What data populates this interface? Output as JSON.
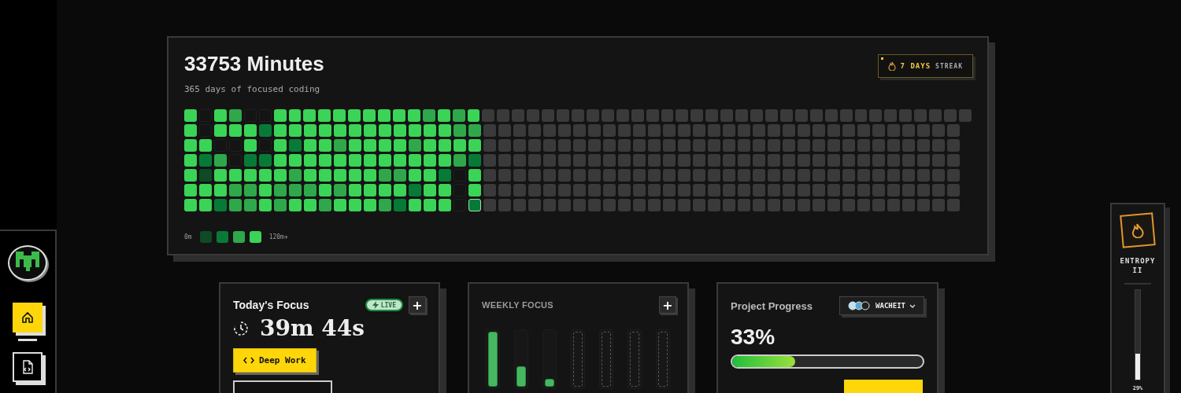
{
  "sidebar": {
    "nav_items": [
      {
        "kind": "home",
        "selected": true
      },
      {
        "kind": "code-file",
        "selected": false
      }
    ]
  },
  "activity": {
    "title": "33753 Minutes",
    "subtitle": "365 days of focused coding",
    "streak": {
      "value": "7 DAYS",
      "label": "STREAK"
    },
    "rows": [
      {
        "cells": [
          {
            "kind": "day",
            "color": "#3ad457"
          },
          {
            "kind": "day",
            "color": "#141414"
          },
          {
            "kind": "day",
            "color": "#3ad457"
          },
          {
            "kind": "day",
            "color": "#2ea84a"
          },
          {
            "kind": "day",
            "color": "#141414"
          },
          {
            "kind": "day",
            "color": "#141414"
          },
          {
            "kind": "day",
            "color": "#3ad457"
          },
          {
            "kind": "day",
            "color": "#3ad457"
          },
          {
            "kind": "day",
            "color": "#3ad457"
          },
          {
            "kind": "day",
            "color": "#3ad457"
          },
          {
            "kind": "day",
            "color": "#3ad457"
          },
          {
            "kind": "day",
            "color": "#3ad457"
          },
          {
            "kind": "day",
            "color": "#3ad457"
          },
          {
            "kind": "day",
            "color": "#3ad457"
          },
          {
            "kind": "day",
            "color": "#3ad457"
          },
          {
            "kind": "day",
            "color": "#3ad457"
          },
          {
            "kind": "day",
            "color": "#2ea84a"
          },
          {
            "kind": "day",
            "color": "#3ad457"
          },
          {
            "kind": "day",
            "color": "#2ea84a"
          },
          {
            "kind": "day",
            "color": "#3ad457"
          },
          {
            "kind": "future",
            "color": "#3a3a3a"
          },
          {
            "kind": "future",
            "color": "#3a3a3a"
          },
          {
            "kind": "future",
            "color": "#3a3a3a"
          },
          {
            "kind": "future",
            "color": "#3a3a3a"
          },
          {
            "kind": "future",
            "color": "#3a3a3a"
          },
          {
            "kind": "future",
            "color": "#3a3a3a"
          },
          {
            "kind": "future",
            "color": "#3a3a3a"
          },
          {
            "kind": "future",
            "color": "#3a3a3a"
          },
          {
            "kind": "future",
            "color": "#3a3a3a"
          },
          {
            "kind": "future",
            "color": "#3a3a3a"
          },
          {
            "kind": "future",
            "color": "#3a3a3a"
          },
          {
            "kind": "future",
            "color": "#3a3a3a"
          },
          {
            "kind": "future",
            "color": "#3a3a3a"
          },
          {
            "kind": "future",
            "color": "#3a3a3a"
          },
          {
            "kind": "future",
            "color": "#3a3a3a"
          },
          {
            "kind": "future",
            "color": "#3a3a3a"
          },
          {
            "kind": "future",
            "color": "#3a3a3a"
          },
          {
            "kind": "future",
            "color": "#3a3a3a"
          },
          {
            "kind": "future",
            "color": "#3a3a3a"
          },
          {
            "kind": "future",
            "color": "#3a3a3a"
          },
          {
            "kind": "future",
            "color": "#3a3a3a"
          },
          {
            "kind": "future",
            "color": "#3a3a3a"
          },
          {
            "kind": "future",
            "color": "#3a3a3a"
          },
          {
            "kind": "future",
            "color": "#3a3a3a"
          },
          {
            "kind": "future",
            "color": "#3a3a3a"
          },
          {
            "kind": "future",
            "color": "#3a3a3a"
          },
          {
            "kind": "future",
            "color": "#3a3a3a"
          },
          {
            "kind": "future",
            "color": "#3a3a3a"
          },
          {
            "kind": "future",
            "color": "#3a3a3a"
          },
          {
            "kind": "future",
            "color": "#3a3a3a"
          },
          {
            "kind": "future",
            "color": "#3a3a3a"
          },
          {
            "kind": "future",
            "color": "#3a3a3a"
          },
          {
            "kind": "future",
            "color": "#3a3a3a"
          }
        ]
      },
      {
        "cells": [
          {
            "kind": "day",
            "color": "#3ad457"
          },
          {
            "kind": "day",
            "color": "#141414"
          },
          {
            "kind": "day",
            "color": "#3ad457"
          },
          {
            "kind": "day",
            "color": "#3ad457"
          },
          {
            "kind": "day",
            "color": "#3ad457"
          },
          {
            "kind": "day",
            "color": "#077a37"
          },
          {
            "kind": "day",
            "color": "#3ad457"
          },
          {
            "kind": "day",
            "color": "#3ad457"
          },
          {
            "kind": "day",
            "color": "#3ad457"
          },
          {
            "kind": "day",
            "color": "#3ad457"
          },
          {
            "kind": "day",
            "color": "#3ad457"
          },
          {
            "kind": "day",
            "color": "#3ad457"
          },
          {
            "kind": "day",
            "color": "#3ad457"
          },
          {
            "kind": "day",
            "color": "#3ad457"
          },
          {
            "kind": "day",
            "color": "#3ad457"
          },
          {
            "kind": "day",
            "color": "#3ad457"
          },
          {
            "kind": "day",
            "color": "#3ad457"
          },
          {
            "kind": "day",
            "color": "#3ad457"
          },
          {
            "kind": "day",
            "color": "#2ea84a"
          },
          {
            "kind": "day",
            "color": "#2ea84a"
          },
          {
            "kind": "future",
            "color": "#3a3a3a"
          },
          {
            "kind": "future",
            "color": "#3a3a3a"
          },
          {
            "kind": "future",
            "color": "#3a3a3a"
          },
          {
            "kind": "future",
            "color": "#3a3a3a"
          },
          {
            "kind": "future",
            "color": "#3a3a3a"
          },
          {
            "kind": "future",
            "color": "#3a3a3a"
          },
          {
            "kind": "future",
            "color": "#3a3a3a"
          },
          {
            "kind": "future",
            "color": "#3a3a3a"
          },
          {
            "kind": "future",
            "color": "#3a3a3a"
          },
          {
            "kind": "future",
            "color": "#3a3a3a"
          },
          {
            "kind": "future",
            "color": "#3a3a3a"
          },
          {
            "kind": "future",
            "color": "#3a3a3a"
          },
          {
            "kind": "future",
            "color": "#3a3a3a"
          },
          {
            "kind": "future",
            "color": "#3a3a3a"
          },
          {
            "kind": "future",
            "color": "#3a3a3a"
          },
          {
            "kind": "future",
            "color": "#3a3a3a"
          },
          {
            "kind": "future",
            "color": "#3a3a3a"
          },
          {
            "kind": "future",
            "color": "#3a3a3a"
          },
          {
            "kind": "future",
            "color": "#3a3a3a"
          },
          {
            "kind": "future",
            "color": "#3a3a3a"
          },
          {
            "kind": "future",
            "color": "#3a3a3a"
          },
          {
            "kind": "future",
            "color": "#3a3a3a"
          },
          {
            "kind": "future",
            "color": "#3a3a3a"
          },
          {
            "kind": "future",
            "color": "#3a3a3a"
          },
          {
            "kind": "future",
            "color": "#3a3a3a"
          },
          {
            "kind": "future",
            "color": "#3a3a3a"
          },
          {
            "kind": "future",
            "color": "#3a3a3a"
          },
          {
            "kind": "future",
            "color": "#3a3a3a"
          },
          {
            "kind": "future",
            "color": "#3a3a3a"
          },
          {
            "kind": "future",
            "color": "#3a3a3a"
          },
          {
            "kind": "future",
            "color": "#3a3a3a"
          },
          {
            "kind": "future",
            "color": "#3a3a3a"
          }
        ]
      },
      {
        "cells": [
          {
            "kind": "day",
            "color": "#3ad457"
          },
          {
            "kind": "day",
            "color": "#3ad457"
          },
          {
            "kind": "day",
            "color": "#141414"
          },
          {
            "kind": "day",
            "color": "#141414"
          },
          {
            "kind": "day",
            "color": "#3ad457"
          },
          {
            "kind": "day",
            "color": "#141414"
          },
          {
            "kind": "day",
            "color": "#3ad457"
          },
          {
            "kind": "day",
            "color": "#077a37"
          },
          {
            "kind": "day",
            "color": "#3ad457"
          },
          {
            "kind": "day",
            "color": "#3ad457"
          },
          {
            "kind": "day",
            "color": "#2ea84a"
          },
          {
            "kind": "day",
            "color": "#3ad457"
          },
          {
            "kind": "day",
            "color": "#3ad457"
          },
          {
            "kind": "day",
            "color": "#3ad457"
          },
          {
            "kind": "day",
            "color": "#3ad457"
          },
          {
            "kind": "day",
            "color": "#2ea84a"
          },
          {
            "kind": "day",
            "color": "#3ad457"
          },
          {
            "kind": "day",
            "color": "#3ad457"
          },
          {
            "kind": "day",
            "color": "#3ad457"
          },
          {
            "kind": "day",
            "color": "#3ad457"
          },
          {
            "kind": "future",
            "color": "#3a3a3a"
          },
          {
            "kind": "future",
            "color": "#3a3a3a"
          },
          {
            "kind": "future",
            "color": "#3a3a3a"
          },
          {
            "kind": "future",
            "color": "#3a3a3a"
          },
          {
            "kind": "future",
            "color": "#3a3a3a"
          },
          {
            "kind": "future",
            "color": "#3a3a3a"
          },
          {
            "kind": "future",
            "color": "#3a3a3a"
          },
          {
            "kind": "future",
            "color": "#3a3a3a"
          },
          {
            "kind": "future",
            "color": "#3a3a3a"
          },
          {
            "kind": "future",
            "color": "#3a3a3a"
          },
          {
            "kind": "future",
            "color": "#3a3a3a"
          },
          {
            "kind": "future",
            "color": "#3a3a3a"
          },
          {
            "kind": "future",
            "color": "#3a3a3a"
          },
          {
            "kind": "future",
            "color": "#3a3a3a"
          },
          {
            "kind": "future",
            "color": "#3a3a3a"
          },
          {
            "kind": "future",
            "color": "#3a3a3a"
          },
          {
            "kind": "future",
            "color": "#3a3a3a"
          },
          {
            "kind": "future",
            "color": "#3a3a3a"
          },
          {
            "kind": "future",
            "color": "#3a3a3a"
          },
          {
            "kind": "future",
            "color": "#3a3a3a"
          },
          {
            "kind": "future",
            "color": "#3a3a3a"
          },
          {
            "kind": "future",
            "color": "#3a3a3a"
          },
          {
            "kind": "future",
            "color": "#3a3a3a"
          },
          {
            "kind": "future",
            "color": "#3a3a3a"
          },
          {
            "kind": "future",
            "color": "#3a3a3a"
          },
          {
            "kind": "future",
            "color": "#3a3a3a"
          },
          {
            "kind": "future",
            "color": "#3a3a3a"
          },
          {
            "kind": "future",
            "color": "#3a3a3a"
          },
          {
            "kind": "future",
            "color": "#3a3a3a"
          },
          {
            "kind": "future",
            "color": "#3a3a3a"
          },
          {
            "kind": "future",
            "color": "#3a3a3a"
          },
          {
            "kind": "future",
            "color": "#3a3a3a"
          }
        ]
      },
      {
        "cells": [
          {
            "kind": "day",
            "color": "#3ad457"
          },
          {
            "kind": "day",
            "color": "#077a37"
          },
          {
            "kind": "day",
            "color": "#2ea84a"
          },
          {
            "kind": "day",
            "color": "#141414"
          },
          {
            "kind": "day",
            "color": "#077a37"
          },
          {
            "kind": "day",
            "color": "#077a37"
          },
          {
            "kind": "day",
            "color": "#3ad457"
          },
          {
            "kind": "day",
            "color": "#3ad457"
          },
          {
            "kind": "day",
            "color": "#3ad457"
          },
          {
            "kind": "day",
            "color": "#3ad457"
          },
          {
            "kind": "day",
            "color": "#3ad457"
          },
          {
            "kind": "day",
            "color": "#3ad457"
          },
          {
            "kind": "day",
            "color": "#3ad457"
          },
          {
            "kind": "day",
            "color": "#3ad457"
          },
          {
            "kind": "day",
            "color": "#3ad457"
          },
          {
            "kind": "day",
            "color": "#3ad457"
          },
          {
            "kind": "day",
            "color": "#3ad457"
          },
          {
            "kind": "day",
            "color": "#3ad457"
          },
          {
            "kind": "day",
            "color": "#2ea84a"
          },
          {
            "kind": "day",
            "color": "#077a37"
          },
          {
            "kind": "future",
            "color": "#3a3a3a"
          },
          {
            "kind": "future",
            "color": "#3a3a3a"
          },
          {
            "kind": "future",
            "color": "#3a3a3a"
          },
          {
            "kind": "future",
            "color": "#3a3a3a"
          },
          {
            "kind": "future",
            "color": "#3a3a3a"
          },
          {
            "kind": "future",
            "color": "#3a3a3a"
          },
          {
            "kind": "future",
            "color": "#3a3a3a"
          },
          {
            "kind": "future",
            "color": "#3a3a3a"
          },
          {
            "kind": "future",
            "color": "#3a3a3a"
          },
          {
            "kind": "future",
            "color": "#3a3a3a"
          },
          {
            "kind": "future",
            "color": "#3a3a3a"
          },
          {
            "kind": "future",
            "color": "#3a3a3a"
          },
          {
            "kind": "future",
            "color": "#3a3a3a"
          },
          {
            "kind": "future",
            "color": "#3a3a3a"
          },
          {
            "kind": "future",
            "color": "#3a3a3a"
          },
          {
            "kind": "future",
            "color": "#3a3a3a"
          },
          {
            "kind": "future",
            "color": "#3a3a3a"
          },
          {
            "kind": "future",
            "color": "#3a3a3a"
          },
          {
            "kind": "future",
            "color": "#3a3a3a"
          },
          {
            "kind": "future",
            "color": "#3a3a3a"
          },
          {
            "kind": "future",
            "color": "#3a3a3a"
          },
          {
            "kind": "future",
            "color": "#3a3a3a"
          },
          {
            "kind": "future",
            "color": "#3a3a3a"
          },
          {
            "kind": "future",
            "color": "#3a3a3a"
          },
          {
            "kind": "future",
            "color": "#3a3a3a"
          },
          {
            "kind": "future",
            "color": "#3a3a3a"
          },
          {
            "kind": "future",
            "color": "#3a3a3a"
          },
          {
            "kind": "future",
            "color": "#3a3a3a"
          },
          {
            "kind": "future",
            "color": "#3a3a3a"
          },
          {
            "kind": "future",
            "color": "#3a3a3a"
          },
          {
            "kind": "future",
            "color": "#3a3a3a"
          },
          {
            "kind": "future",
            "color": "#3a3a3a"
          }
        ]
      },
      {
        "cells": [
          {
            "kind": "day",
            "color": "#3ad457"
          },
          {
            "kind": "day",
            "color": "#0e4a26"
          },
          {
            "kind": "day",
            "color": "#3ad457"
          },
          {
            "kind": "day",
            "color": "#3ad457"
          },
          {
            "kind": "day",
            "color": "#3ad457"
          },
          {
            "kind": "day",
            "color": "#3ad457"
          },
          {
            "kind": "day",
            "color": "#3ad457"
          },
          {
            "kind": "day",
            "color": "#2ea84a"
          },
          {
            "kind": "day",
            "color": "#3ad457"
          },
          {
            "kind": "day",
            "color": "#3ad457"
          },
          {
            "kind": "day",
            "color": "#3ad457"
          },
          {
            "kind": "day",
            "color": "#3ad457"
          },
          {
            "kind": "day",
            "color": "#3ad457"
          },
          {
            "kind": "day",
            "color": "#2ea84a"
          },
          {
            "kind": "day",
            "color": "#2ea84a"
          },
          {
            "kind": "day",
            "color": "#3ad457"
          },
          {
            "kind": "day",
            "color": "#3ad457"
          },
          {
            "kind": "day",
            "color": "#077a37"
          },
          {
            "kind": "day",
            "color": "#141414"
          },
          {
            "kind": "day",
            "color": "#3ad457"
          },
          {
            "kind": "future",
            "color": "#3a3a3a"
          },
          {
            "kind": "future",
            "color": "#3a3a3a"
          },
          {
            "kind": "future",
            "color": "#3a3a3a"
          },
          {
            "kind": "future",
            "color": "#3a3a3a"
          },
          {
            "kind": "future",
            "color": "#3a3a3a"
          },
          {
            "kind": "future",
            "color": "#3a3a3a"
          },
          {
            "kind": "future",
            "color": "#3a3a3a"
          },
          {
            "kind": "future",
            "color": "#3a3a3a"
          },
          {
            "kind": "future",
            "color": "#3a3a3a"
          },
          {
            "kind": "future",
            "color": "#3a3a3a"
          },
          {
            "kind": "future",
            "color": "#3a3a3a"
          },
          {
            "kind": "future",
            "color": "#3a3a3a"
          },
          {
            "kind": "future",
            "color": "#3a3a3a"
          },
          {
            "kind": "future",
            "color": "#3a3a3a"
          },
          {
            "kind": "future",
            "color": "#3a3a3a"
          },
          {
            "kind": "future",
            "color": "#3a3a3a"
          },
          {
            "kind": "future",
            "color": "#3a3a3a"
          },
          {
            "kind": "future",
            "color": "#3a3a3a"
          },
          {
            "kind": "future",
            "color": "#3a3a3a"
          },
          {
            "kind": "future",
            "color": "#3a3a3a"
          },
          {
            "kind": "future",
            "color": "#3a3a3a"
          },
          {
            "kind": "future",
            "color": "#3a3a3a"
          },
          {
            "kind": "future",
            "color": "#3a3a3a"
          },
          {
            "kind": "future",
            "color": "#3a3a3a"
          },
          {
            "kind": "future",
            "color": "#3a3a3a"
          },
          {
            "kind": "future",
            "color": "#3a3a3a"
          },
          {
            "kind": "future",
            "color": "#3a3a3a"
          },
          {
            "kind": "future",
            "color": "#3a3a3a"
          },
          {
            "kind": "future",
            "color": "#3a3a3a"
          },
          {
            "kind": "future",
            "color": "#3a3a3a"
          },
          {
            "kind": "future",
            "color": "#3a3a3a"
          },
          {
            "kind": "future",
            "color": "#3a3a3a"
          }
        ]
      },
      {
        "cells": [
          {
            "kind": "day",
            "color": "#3ad457"
          },
          {
            "kind": "day",
            "color": "#3ad457"
          },
          {
            "kind": "day",
            "color": "#3ad457"
          },
          {
            "kind": "day",
            "color": "#2ea84a"
          },
          {
            "kind": "day",
            "color": "#2ea84a"
          },
          {
            "kind": "day",
            "color": "#3ad457"
          },
          {
            "kind": "day",
            "color": "#2ea84a"
          },
          {
            "kind": "day",
            "color": "#2ea84a"
          },
          {
            "kind": "day",
            "color": "#2ea84a"
          },
          {
            "kind": "day",
            "color": "#3ad457"
          },
          {
            "kind": "day",
            "color": "#2ea84a"
          },
          {
            "kind": "day",
            "color": "#3ad457"
          },
          {
            "kind": "day",
            "color": "#3ad457"
          },
          {
            "kind": "day",
            "color": "#3ad457"
          },
          {
            "kind": "day",
            "color": "#3ad457"
          },
          {
            "kind": "day",
            "color": "#077a37"
          },
          {
            "kind": "day",
            "color": "#3ad457"
          },
          {
            "kind": "day",
            "color": "#3ad457"
          },
          {
            "kind": "day",
            "color": "#141414"
          },
          {
            "kind": "day",
            "color": "#3ad457"
          },
          {
            "kind": "future",
            "color": "#3a3a3a"
          },
          {
            "kind": "future",
            "color": "#3a3a3a"
          },
          {
            "kind": "future",
            "color": "#3a3a3a"
          },
          {
            "kind": "future",
            "color": "#3a3a3a"
          },
          {
            "kind": "future",
            "color": "#3a3a3a"
          },
          {
            "kind": "future",
            "color": "#3a3a3a"
          },
          {
            "kind": "future",
            "color": "#3a3a3a"
          },
          {
            "kind": "future",
            "color": "#3a3a3a"
          },
          {
            "kind": "future",
            "color": "#3a3a3a"
          },
          {
            "kind": "future",
            "color": "#3a3a3a"
          },
          {
            "kind": "future",
            "color": "#3a3a3a"
          },
          {
            "kind": "future",
            "color": "#3a3a3a"
          },
          {
            "kind": "future",
            "color": "#3a3a3a"
          },
          {
            "kind": "future",
            "color": "#3a3a3a"
          },
          {
            "kind": "future",
            "color": "#3a3a3a"
          },
          {
            "kind": "future",
            "color": "#3a3a3a"
          },
          {
            "kind": "future",
            "color": "#3a3a3a"
          },
          {
            "kind": "future",
            "color": "#3a3a3a"
          },
          {
            "kind": "future",
            "color": "#3a3a3a"
          },
          {
            "kind": "future",
            "color": "#3a3a3a"
          },
          {
            "kind": "future",
            "color": "#3a3a3a"
          },
          {
            "kind": "future",
            "color": "#3a3a3a"
          },
          {
            "kind": "future",
            "color": "#3a3a3a"
          },
          {
            "kind": "future",
            "color": "#3a3a3a"
          },
          {
            "kind": "future",
            "color": "#3a3a3a"
          },
          {
            "kind": "future",
            "color": "#3a3a3a"
          },
          {
            "kind": "future",
            "color": "#3a3a3a"
          },
          {
            "kind": "future",
            "color": "#3a3a3a"
          },
          {
            "kind": "future",
            "color": "#3a3a3a"
          },
          {
            "kind": "future",
            "color": "#3a3a3a"
          },
          {
            "kind": "future",
            "color": "#3a3a3a"
          },
          {
            "kind": "future",
            "color": "#3a3a3a"
          }
        ]
      },
      {
        "cells": [
          {
            "kind": "day",
            "color": "#3ad457"
          },
          {
            "kind": "day",
            "color": "#3ad457"
          },
          {
            "kind": "day",
            "color": "#077a37"
          },
          {
            "kind": "day",
            "color": "#2ea84a"
          },
          {
            "kind": "day",
            "color": "#2ea84a"
          },
          {
            "kind": "day",
            "color": "#3ad457"
          },
          {
            "kind": "day",
            "color": "#2ea84a"
          },
          {
            "kind": "day",
            "color": "#3ad457"
          },
          {
            "kind": "day",
            "color": "#3ad457"
          },
          {
            "kind": "day",
            "color": "#2ea84a"
          },
          {
            "kind": "day",
            "color": "#3ad457"
          },
          {
            "kind": "day",
            "color": "#3ad457"
          },
          {
            "kind": "day",
            "color": "#3ad457"
          },
          {
            "kind": "day",
            "color": "#2ea84a"
          },
          {
            "kind": "day",
            "color": "#077a37"
          },
          {
            "kind": "day",
            "color": "#3ad457"
          },
          {
            "kind": "day",
            "color": "#3ad457"
          },
          {
            "kind": "day",
            "color": "#3ad457"
          },
          {
            "kind": "day",
            "color": "#141414"
          },
          {
            "kind": "today",
            "color": "#077a37"
          },
          {
            "kind": "future",
            "color": "#3a3a3a"
          },
          {
            "kind": "future",
            "color": "#3a3a3a"
          },
          {
            "kind": "future",
            "color": "#3a3a3a"
          },
          {
            "kind": "future",
            "color": "#3a3a3a"
          },
          {
            "kind": "future",
            "color": "#3a3a3a"
          },
          {
            "kind": "future",
            "color": "#3a3a3a"
          },
          {
            "kind": "future",
            "color": "#3a3a3a"
          },
          {
            "kind": "future",
            "color": "#3a3a3a"
          },
          {
            "kind": "future",
            "color": "#3a3a3a"
          },
          {
            "kind": "future",
            "color": "#3a3a3a"
          },
          {
            "kind": "future",
            "color": "#3a3a3a"
          },
          {
            "kind": "future",
            "color": "#3a3a3a"
          },
          {
            "kind": "future",
            "color": "#3a3a3a"
          },
          {
            "kind": "future",
            "color": "#3a3a3a"
          },
          {
            "kind": "future",
            "color": "#3a3a3a"
          },
          {
            "kind": "future",
            "color": "#3a3a3a"
          },
          {
            "kind": "future",
            "color": "#3a3a3a"
          },
          {
            "kind": "future",
            "color": "#3a3a3a"
          },
          {
            "kind": "future",
            "color": "#3a3a3a"
          },
          {
            "kind": "future",
            "color": "#3a3a3a"
          },
          {
            "kind": "future",
            "color": "#3a3a3a"
          },
          {
            "kind": "future",
            "color": "#3a3a3a"
          },
          {
            "kind": "future",
            "color": "#3a3a3a"
          },
          {
            "kind": "future",
            "color": "#3a3a3a"
          },
          {
            "kind": "future",
            "color": "#3a3a3a"
          },
          {
            "kind": "future",
            "color": "#3a3a3a"
          },
          {
            "kind": "future",
            "color": "#3a3a3a"
          },
          {
            "kind": "future",
            "color": "#3a3a3a"
          },
          {
            "kind": "future",
            "color": "#3a3a3a"
          },
          {
            "kind": "future",
            "color": "#3a3a3a"
          },
          {
            "kind": "future",
            "color": "#3a3a3a"
          },
          {
            "kind": "future",
            "color": "#3a3a3a"
          }
        ]
      }
    ],
    "legend": {
      "min_label": "0m",
      "max_label": "120m+"
    }
  },
  "today_focus": {
    "title": "Today's Focus",
    "live_badge": "LIVE",
    "add_button": "+",
    "time": "39m 44s",
    "mode_button": "Deep Work"
  },
  "weekly_focus": {
    "title": "WEEKLY FOCUS",
    "add_button": "+",
    "bars": [
      {
        "kind": "done",
        "level": 1
      },
      {
        "kind": "done",
        "level": 0.37
      },
      {
        "kind": "done",
        "level": 0.14
      },
      {
        "kind": "pending"
      },
      {
        "kind": "pending"
      },
      {
        "kind": "pending"
      },
      {
        "kind": "pending"
      }
    ]
  },
  "project_progress": {
    "title": "Project Progress",
    "project": "WACHEIT",
    "percent": "33%",
    "level": 0.33
  },
  "entropy": {
    "label": "ENTROPY II",
    "level": 0.29,
    "reading": "29%"
  }
}
